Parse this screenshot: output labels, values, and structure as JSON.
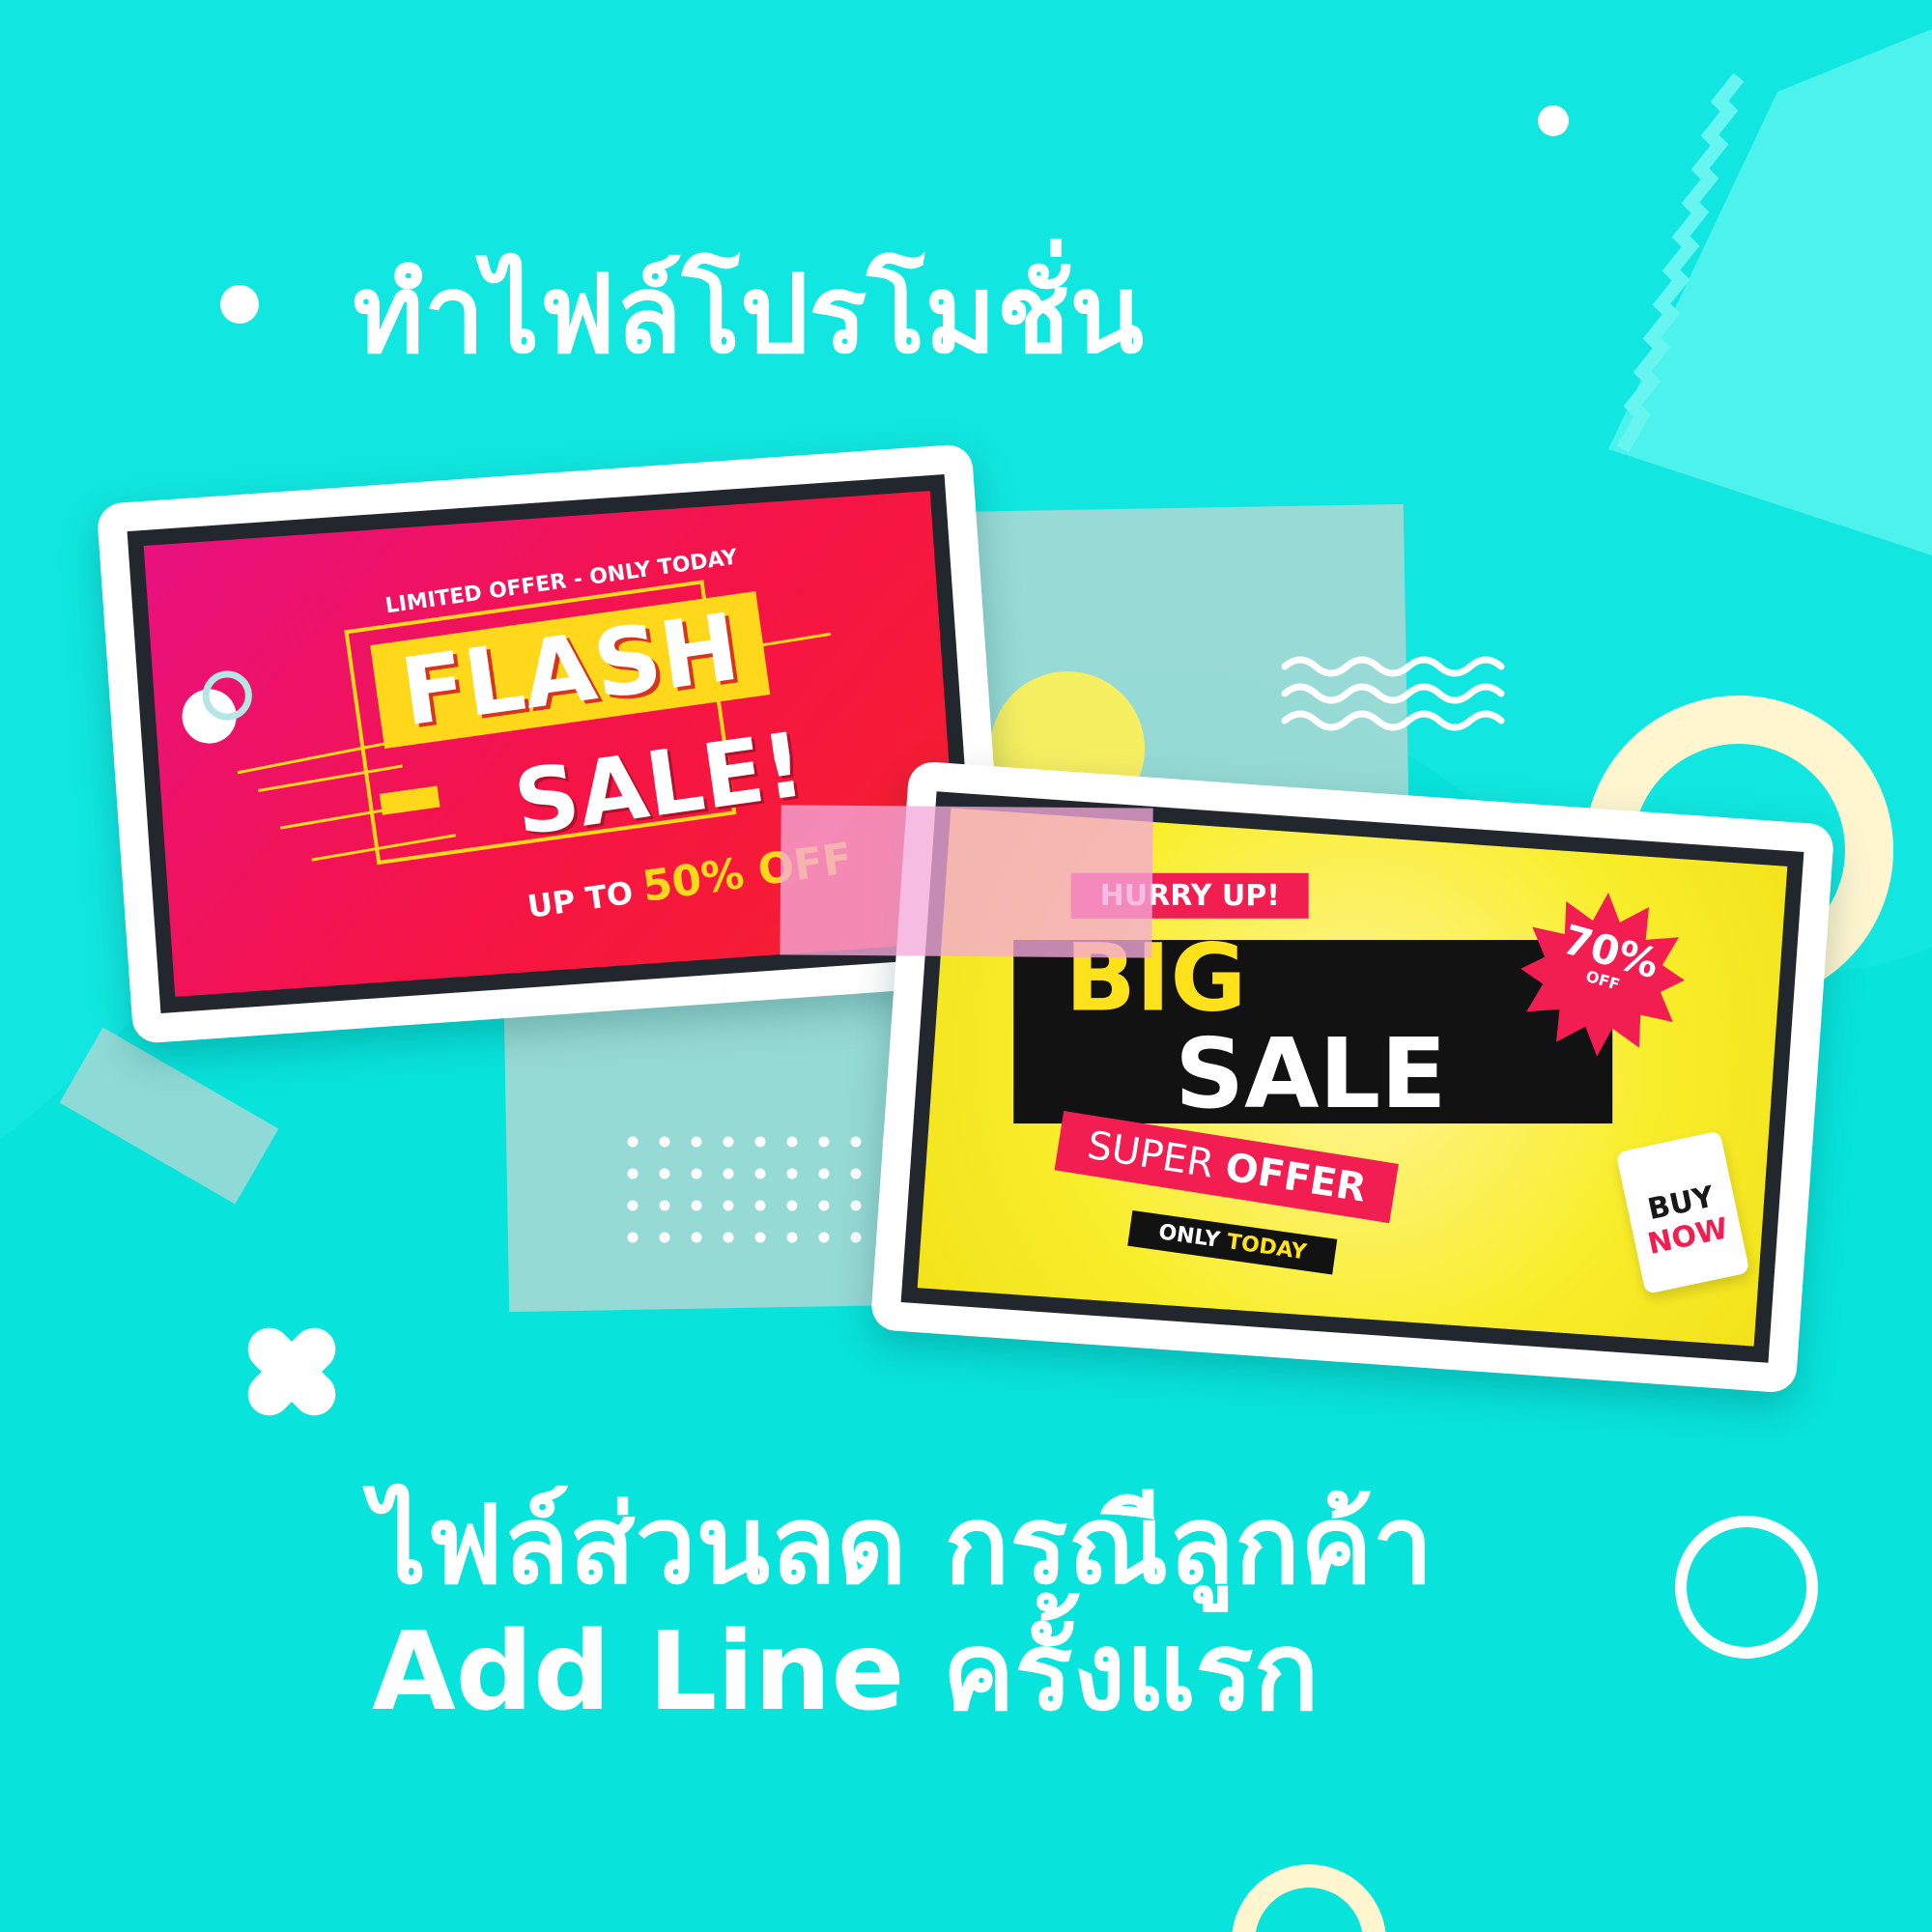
{
  "title": "ทำไฟล์โปรโมชั่น",
  "subtitle": {
    "line1": "ไฟล์ส่วนลด กรณีลูกค้า",
    "line2": "Add Line ครั้งแรก"
  },
  "flash_card": {
    "limited_offer": "LIMITED OFFER - ONLY TODAY",
    "flash": "FLASH",
    "sale": "SALE!",
    "up_to": "UP TO",
    "discount": "50% OFF"
  },
  "big_card": {
    "hurry": "HURRY UP!",
    "big": "BIG",
    "sale": "SALE",
    "super": "SUPER",
    "offer": "OFFER",
    "only": "ONLY",
    "today": "TODAY",
    "percent": "70%",
    "off": "OFF",
    "buy": "BUY",
    "now": "NOW"
  },
  "colors": {
    "background": "#08e3dc",
    "flash_pink": "#e8117f",
    "flash_red": "#f7202a",
    "big_yellow": "#f9ee2c",
    "accent_red": "#f21e52",
    "cream": "#fff6d0"
  },
  "icons": [
    "wave-icon",
    "cross-icon",
    "ring-icon",
    "dot-icon",
    "zigzag-icon"
  ]
}
